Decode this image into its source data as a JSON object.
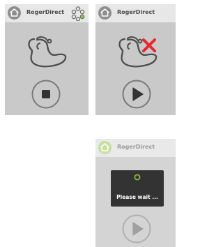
{
  "screens": [
    {
      "app_title": "RogerDirect",
      "home_icon": "home-icon",
      "menu_icon": "dots-menu-icon",
      "device_icon": "hearing-aid-icon",
      "control": "stop",
      "control_icon": "stop-icon",
      "status": "connected"
    },
    {
      "app_title": "RogerDirect",
      "home_icon": "home-icon",
      "device_icon": "hearing-aid-icon",
      "error_icon": "red-x-icon",
      "control": "play",
      "control_icon": "play-icon",
      "status": "disconnected"
    },
    {
      "app_title": "RogerDirect",
      "home_icon": "home-icon",
      "device_icon": "hearing-aid-icon",
      "control": "play",
      "control_icon": "play-icon",
      "loading": {
        "icon": "spinner-icon",
        "message": "Please wait ..."
      }
    }
  ],
  "colors": {
    "screen_bg": "#c9c9c9",
    "header_bg": "#e7e7e7",
    "icon_gray": "#8d8d8d",
    "accent_green": "#8dc63f",
    "error_red": "#e8262d",
    "toast_bg": "#333333"
  }
}
